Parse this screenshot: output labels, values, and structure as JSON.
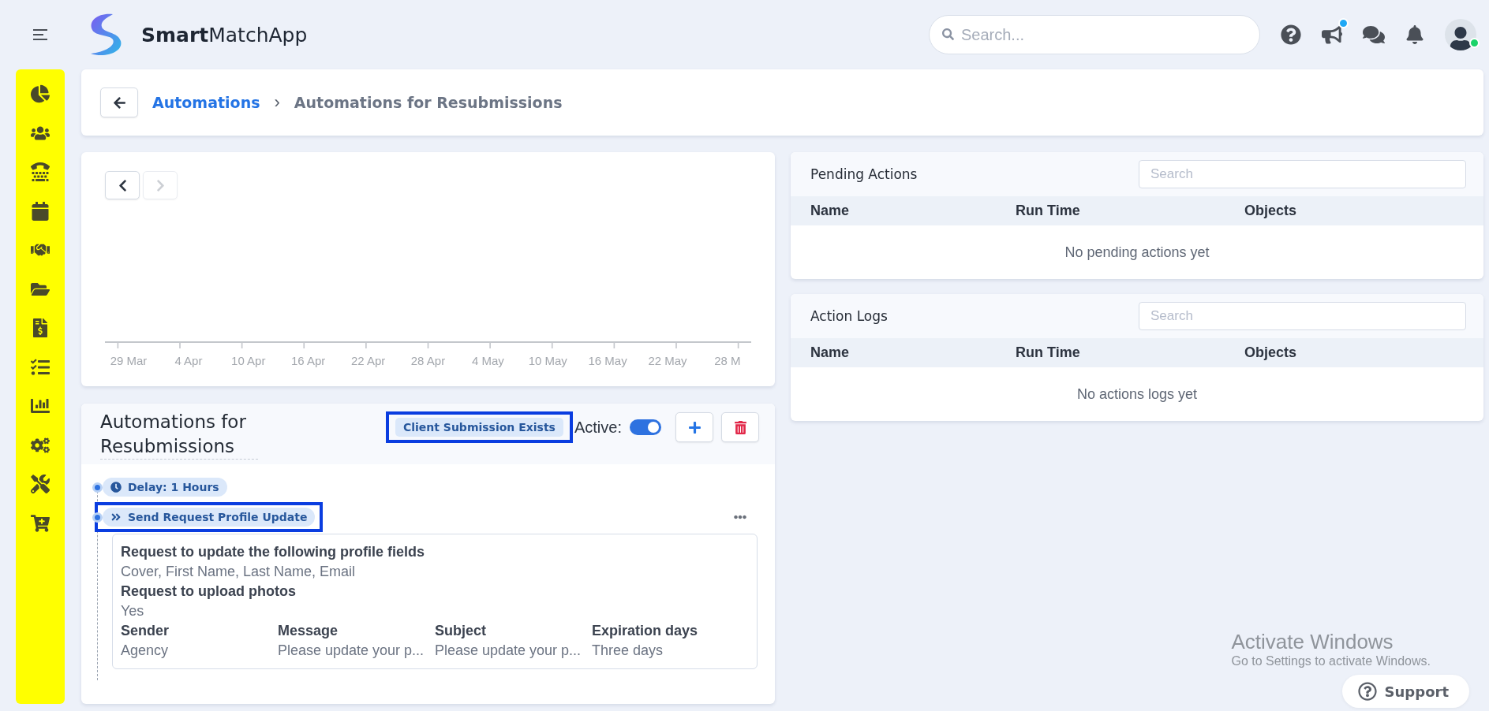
{
  "header": {
    "brand_bold": "Smart",
    "brand_rest": "MatchApp",
    "search": {
      "placeholder": "Search..."
    },
    "alert_dot": true,
    "user_online": true
  },
  "breadcrumb": {
    "link": "Automations",
    "separator": "›",
    "current": "Automations for Resubmissions"
  },
  "chart": {
    "prev_enabled": true,
    "next_enabled": false,
    "x_labels": [
      "29 Mar",
      "4 Apr",
      "10 Apr",
      "16 Apr",
      "22 Apr",
      "28 Apr",
      "4 May",
      "10 May",
      "16 May",
      "22 May",
      "28 M"
    ]
  },
  "automation": {
    "title": "Automations for Resubmissions",
    "trigger": "Client Submission Exists",
    "trigger_highlighted": true,
    "active_label": "Active:",
    "active": true,
    "steps": [
      {
        "kind": "delay",
        "label": "Delay: 1 Hours",
        "highlighted": false
      },
      {
        "kind": "action",
        "label": "Send Request Profile Update",
        "highlighted": true,
        "fields": [
          {
            "label": "Request to update the following profile fields",
            "value": "Cover, First Name, Last Name, Email"
          },
          {
            "label": "Request to upload photos",
            "value": "Yes"
          }
        ],
        "columns": [
          {
            "label": "Sender",
            "value": "Agency"
          },
          {
            "label": "Message",
            "value": "Please update your p..."
          },
          {
            "label": "Subject",
            "value": "Please update your p..."
          },
          {
            "label": "Expiration days",
            "value": "Three days"
          }
        ]
      }
    ]
  },
  "panels": [
    {
      "title": "Pending Actions",
      "search_placeholder": "Search",
      "columns": [
        "Name",
        "Run Time",
        "Objects"
      ],
      "empty_text": "No pending actions yet"
    },
    {
      "title": "Action Logs",
      "search_placeholder": "Search",
      "columns": [
        "Name",
        "Run Time",
        "Objects"
      ],
      "empty_text": "No actions logs yet"
    }
  ],
  "windows_notice": {
    "title": "Activate Windows",
    "text": "Go to Settings to activate Windows."
  },
  "support": {
    "label": "Support"
  }
}
